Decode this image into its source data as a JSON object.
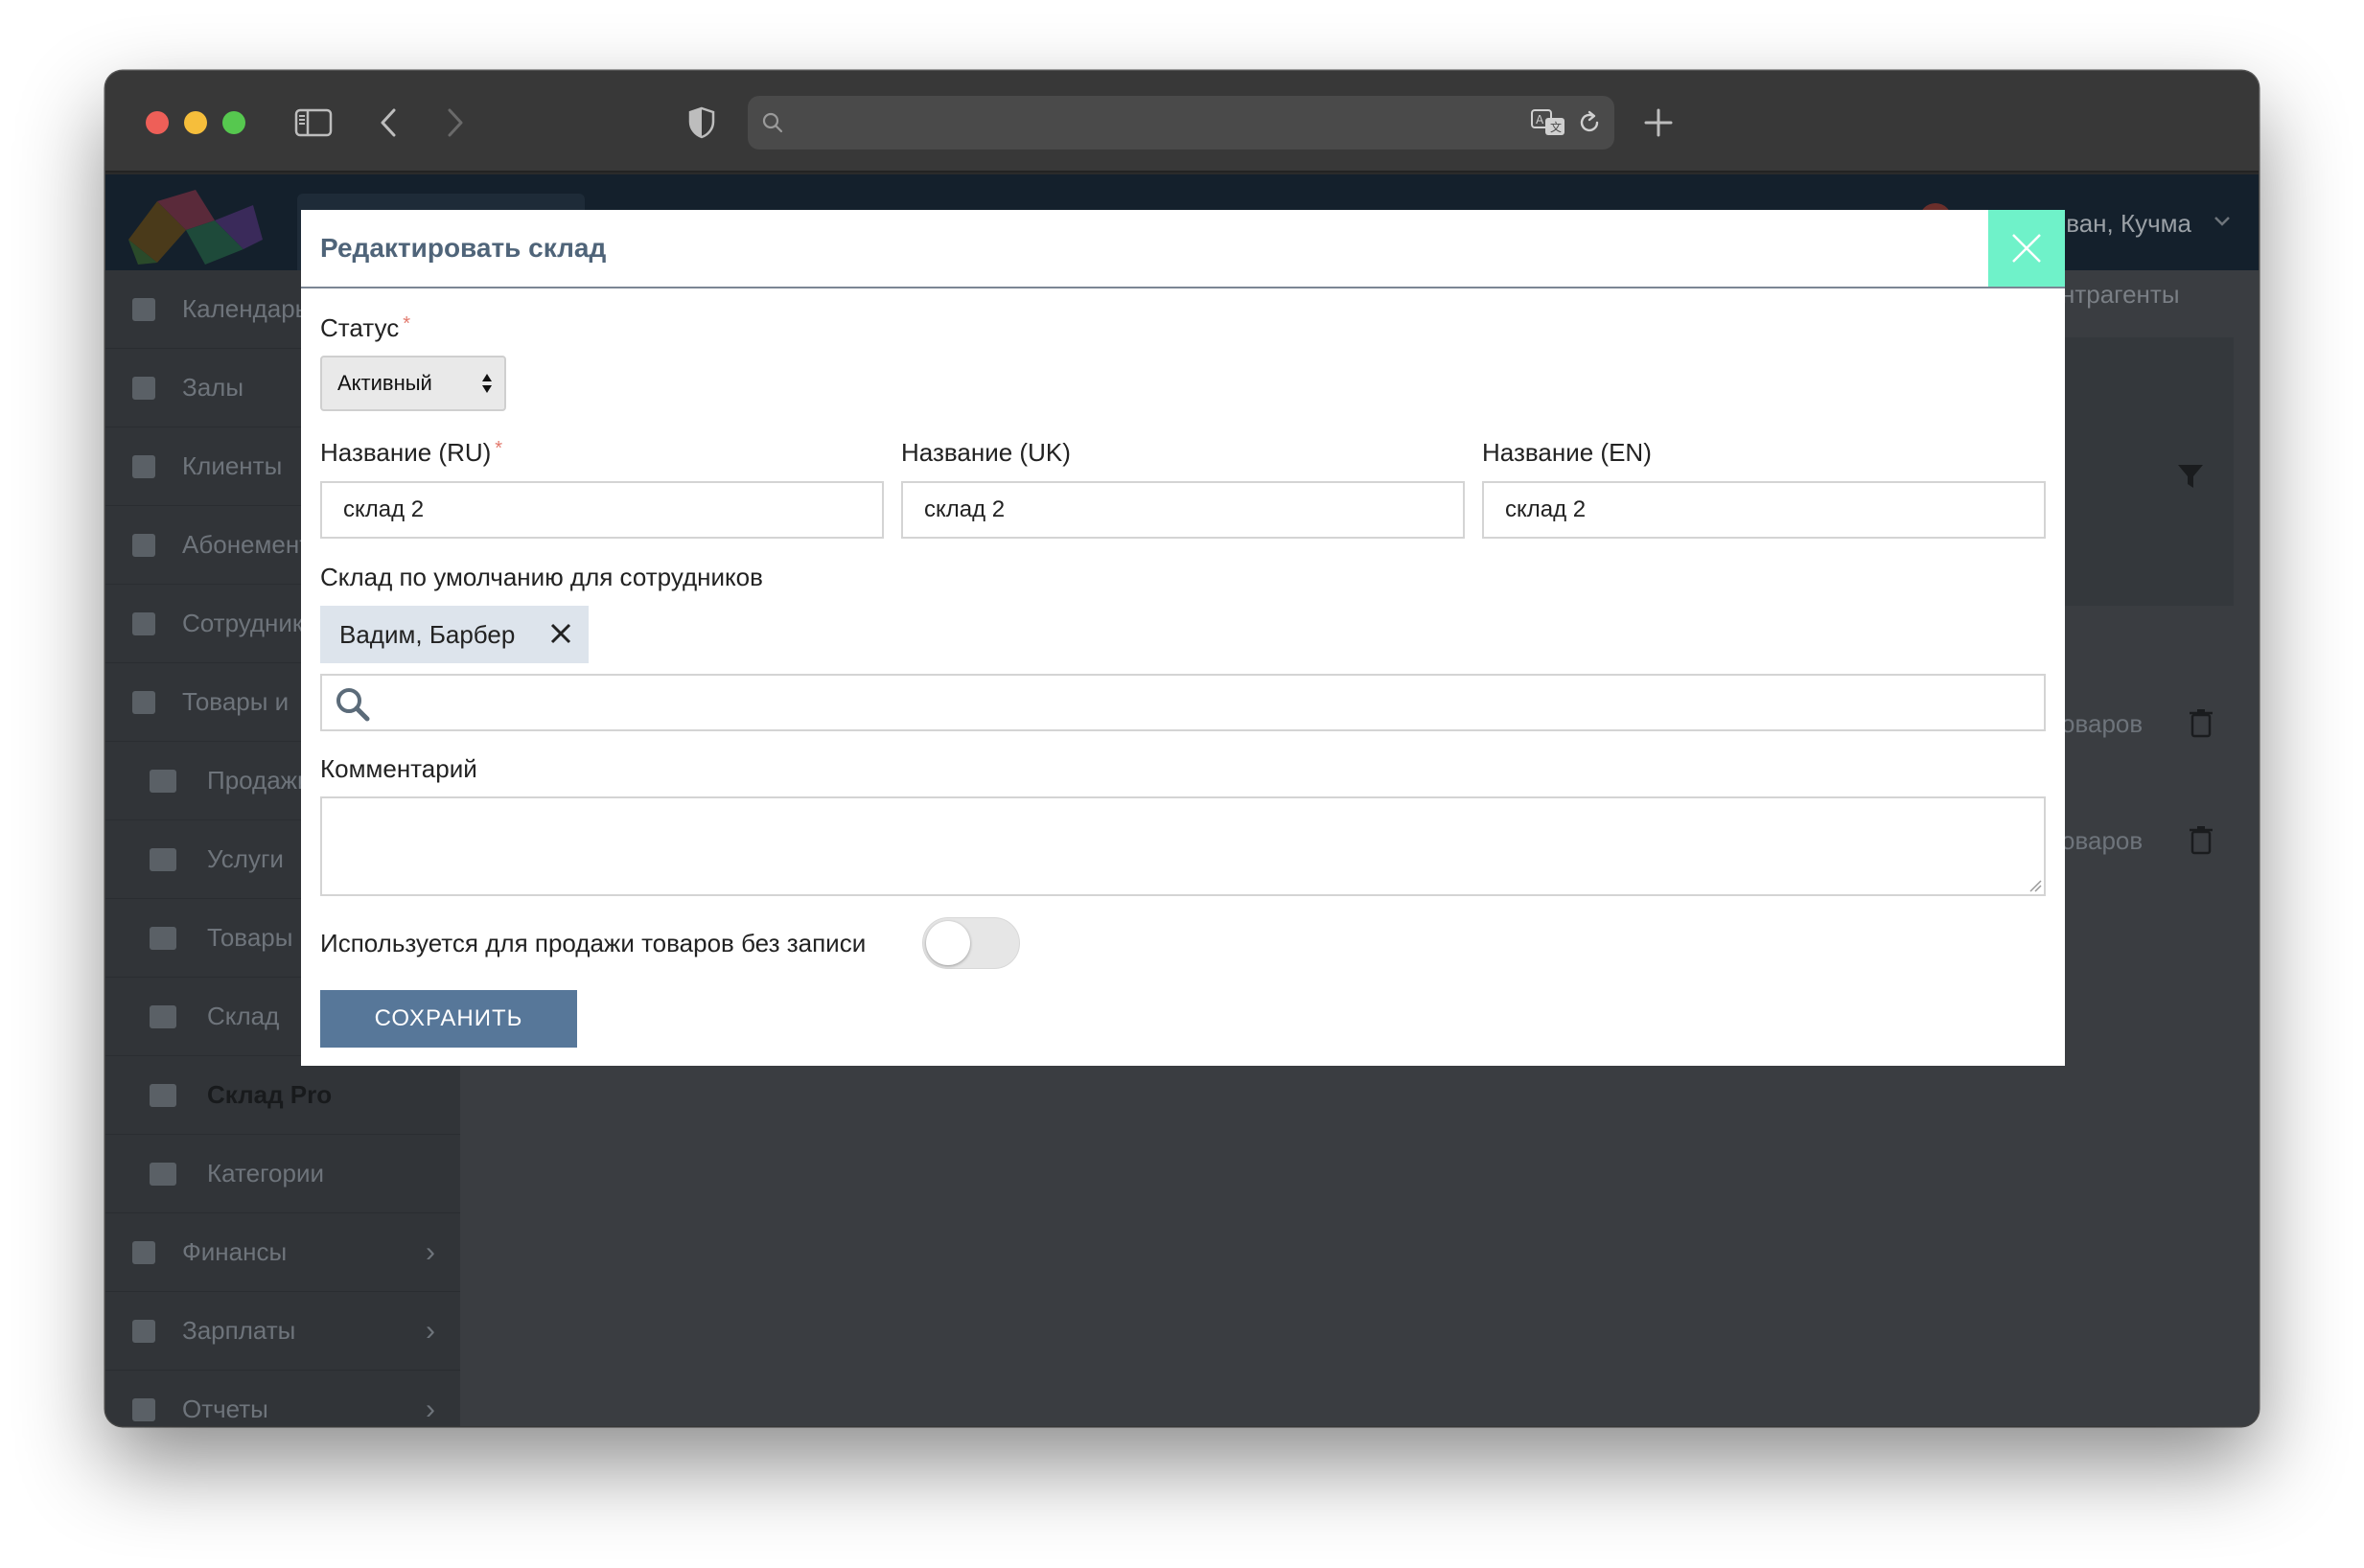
{
  "browser": {
    "address_text": "",
    "icons": [
      "sidebar-icon",
      "back-arrow-icon",
      "forward-arrow-icon",
      "shield-icon",
      "search-icon",
      "translate-icon",
      "reload-icon",
      "plus-icon"
    ]
  },
  "header": {
    "user_name": "ван, Кучма"
  },
  "sidebar": {
    "items": [
      {
        "label": "Календарь",
        "icon": "calendar-icon"
      },
      {
        "label": "Залы",
        "icon": "bookmark-icon"
      },
      {
        "label": "Клиенты",
        "icon": "users-icon"
      },
      {
        "label": "Абонементы",
        "icon": "card-icon"
      },
      {
        "label": "Сотрудники",
        "icon": "id-card-icon"
      },
      {
        "label": "Товары и",
        "icon": "card-icon"
      },
      {
        "label": "Продажи",
        "icon": "scales-icon"
      },
      {
        "label": "Услуги",
        "icon": "scissors-icon"
      },
      {
        "label": "Товары",
        "icon": "tag-icon"
      },
      {
        "label": "Склад",
        "icon": "bank-icon"
      },
      {
        "label": "Склад Pro",
        "icon": "bank-icon"
      },
      {
        "label": "Категории",
        "icon": "tags-icon"
      },
      {
        "label": "Финансы",
        "icon": "money-icon"
      },
      {
        "label": "Зарплаты",
        "icon": "grid-icon"
      },
      {
        "label": "Отчеты",
        "icon": "bar-chart-icon"
      }
    ]
  },
  "main": {
    "right_title": "нтрагенты",
    "rows": [
      {
        "text": "оваров"
      },
      {
        "text": "оваров"
      }
    ]
  },
  "modal": {
    "title": "Редактировать склад",
    "status_label": "Статус",
    "status_value": "Активный",
    "name_ru_label": "Название (RU)",
    "name_ru_value": "склад 2",
    "name_uk_label": "Название (UK)",
    "name_uk_value": "склад 2",
    "name_en_label": "Название (EN)",
    "name_en_value": "склад 2",
    "default_staff_label": "Склад по умолчанию для сотрудников",
    "selected_staff": "Вадим, Барбер",
    "comment_label": "Комментарий",
    "comment_value": "",
    "no_booking_label": "Используется для продажи товаров без записи",
    "no_booking_enabled": false,
    "save_label": "СОХРАНИТЬ",
    "required_mark": "*"
  },
  "colors": {
    "modal_title": "#4f6479",
    "close_button": "#6ff2c9",
    "save_button": "#577799",
    "chip_bg": "#dde4ec",
    "required": "#e2786c"
  }
}
